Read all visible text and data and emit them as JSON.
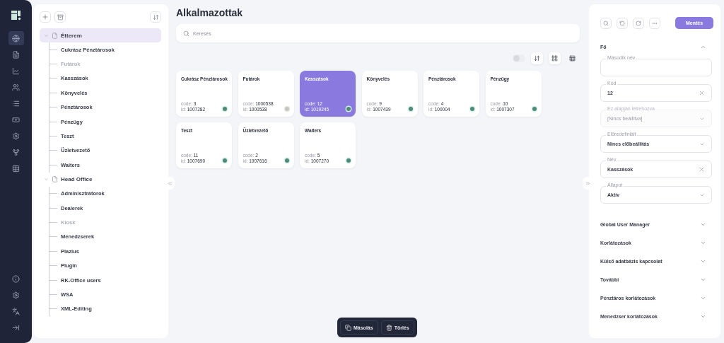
{
  "nav": {
    "items": [
      {
        "kind": "globe",
        "selected": true
      },
      {
        "kind": "document",
        "selected": false
      },
      {
        "kind": "chart",
        "selected": false
      },
      {
        "kind": "users",
        "selected": false
      },
      {
        "kind": "list",
        "selected": false
      },
      {
        "kind": "money",
        "selected": false
      },
      {
        "kind": "settings",
        "selected": false
      },
      {
        "kind": "branch",
        "selected": false
      },
      {
        "kind": "table",
        "selected": false
      }
    ],
    "bottom": [
      {
        "kind": "info"
      },
      {
        "kind": "settings"
      },
      {
        "kind": "translate"
      },
      {
        "kind": "collapse"
      }
    ]
  },
  "tree": {
    "groups": [
      {
        "label": "Étterem",
        "expanded": true,
        "selected": true,
        "children": [
          {
            "label": "Cukrász Pénztárosok",
            "disabled": false
          },
          {
            "label": "Futárok",
            "disabled": true
          },
          {
            "label": "Kasszások",
            "disabled": false
          },
          {
            "label": "Könyvelés",
            "disabled": false
          },
          {
            "label": "Pénztárosok",
            "disabled": false
          },
          {
            "label": "Pénzügy",
            "disabled": false
          },
          {
            "label": "Teszt",
            "disabled": false
          },
          {
            "label": "Üzletvezető",
            "disabled": false
          },
          {
            "label": "Waiters",
            "disabled": false
          }
        ]
      },
      {
        "label": "Head Office",
        "expanded": true,
        "selected": false,
        "children": [
          {
            "label": "Adminisztrátorok",
            "disabled": false
          },
          {
            "label": "Dealerek",
            "disabled": false
          },
          {
            "label": "Kiosk",
            "disabled": true
          },
          {
            "label": "Menedzserek",
            "disabled": false
          },
          {
            "label": "Plazius",
            "disabled": false
          },
          {
            "label": "Plugin",
            "disabled": false
          },
          {
            "label": "RK-Office users",
            "disabled": false
          },
          {
            "label": "WSA",
            "disabled": false
          },
          {
            "label": "XML-Editing",
            "disabled": false
          }
        ]
      }
    ]
  },
  "main": {
    "title": "Alkalmazottak",
    "search": {
      "placeholder": "Keresés"
    },
    "toolbar": {
      "toggle_on": false,
      "views": [
        {
          "kind": "grid",
          "selected": true
        },
        {
          "kind": "table",
          "selected": false
        }
      ]
    },
    "cards": [
      {
        "name": "Cukrász Pénztárosok",
        "code_label": "code:",
        "code": "3",
        "id_label": "id:",
        "id": "1007282",
        "active": true,
        "selected": false
      },
      {
        "name": "Futárok",
        "code_label": "code:",
        "code": "1000538",
        "id_label": "id:",
        "id": "1000538",
        "active": false,
        "selected": false
      },
      {
        "name": "Kasszások",
        "code_label": "code:",
        "code": "12",
        "id_label": "id:",
        "id": "1019245",
        "active": true,
        "selected": true
      },
      {
        "name": "Könyvelés",
        "code_label": "code:",
        "code": "9",
        "id_label": "id:",
        "id": "1007439",
        "active": true,
        "selected": false
      },
      {
        "name": "Pénztárosok",
        "code_label": "code:",
        "code": "4",
        "id_label": "id:",
        "id": "100004",
        "active": true,
        "selected": false
      },
      {
        "name": "Pénzügy",
        "code_label": "code:",
        "code": "10",
        "id_label": "id:",
        "id": "1007307",
        "active": true,
        "selected": false
      },
      {
        "name": "Teszt",
        "code_label": "code:",
        "code": "11",
        "id_label": "id:",
        "id": "1007690",
        "active": true,
        "selected": false
      },
      {
        "name": "Üzletvezető",
        "code_label": "code:",
        "code": "2",
        "id_label": "id:",
        "id": "1007616",
        "active": true,
        "selected": false
      },
      {
        "name": "Waiters",
        "code_label": "code:",
        "code": "5",
        "id_label": "id:",
        "id": "1007270",
        "active": true,
        "selected": false
      }
    ],
    "actions": [
      {
        "kind": "copy",
        "label": "Másolás"
      },
      {
        "kind": "delete",
        "label": "Törlés"
      }
    ]
  },
  "details": {
    "save": "Mentés",
    "sections": [
      {
        "title": "Fő",
        "expanded": true,
        "fields": [
          {
            "label": "Második név",
            "kind": "text",
            "disabled": false
          },
          {
            "label": "Kód",
            "kind": "text",
            "value": "12",
            "clearable": true,
            "disabled": false
          },
          {
            "label": "Ez alapján létrehozva",
            "kind": "select",
            "value": "[Nincs beállítva]",
            "disabled": true
          },
          {
            "label": "Előredefiniált",
            "kind": "select",
            "value": "Nincs előbeállítás",
            "disabled": false
          },
          {
            "label": "Név",
            "kind": "text",
            "value": "Kasszások",
            "clearable": true,
            "disabled": false
          },
          {
            "label": "Állapot",
            "kind": "select",
            "value": "Aktív",
            "disabled": false
          }
        ]
      },
      {
        "title": "Global User Manager",
        "expanded": false
      },
      {
        "title": "Korlátozások",
        "expanded": false
      },
      {
        "title": "Külső adatbázis kapcsolat",
        "expanded": false
      },
      {
        "title": "További",
        "expanded": false
      },
      {
        "title": "Pénztáros korlátozások",
        "expanded": false
      },
      {
        "title": "Menedzser korlátozások",
        "expanded": false
      }
    ]
  }
}
